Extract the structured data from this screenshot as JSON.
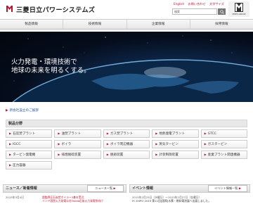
{
  "header": {
    "brand": "三菱日立パワーシステムズ",
    "util_links": [
      "English",
      "お問い合わせ",
      "文字サイズ"
    ],
    "search_placeholder": "検索",
    "search_button": "検索",
    "group_logo_text": "MHPS GROUP"
  },
  "nav": [
    "製品情報",
    "技術情報",
    "企業情報",
    "採用情報"
  ],
  "hero": {
    "line1": "火力発電・環境技術で",
    "line2": "地球の未来を明るくする。"
  },
  "notice": "新会社設立のご挨拶",
  "products": {
    "title": "製品分野",
    "items": [
      "石炭焚プラント",
      "油焚プラント",
      "ガス焚プラント",
      "地熱発電プラント",
      "GTCC",
      "IGCC",
      "ボイラ",
      "ボイラ周辺機器",
      "蒸気タービン",
      "ガスタービン",
      "タービン発電機",
      "排煙脱硫装置",
      "脱硝装置",
      "計装制御装置",
      "産業プラント関連機器",
      "圧力容器"
    ]
  },
  "news": {
    "title": "ニュース／新着情報",
    "button": "ニュース一覧",
    "date": "2015年3月4日",
    "lines": [
      "超臨界圧石炭焚ボイラー3基を受注",
      "インド国営火力発電公社Tanda石炭火力発電所向け"
    ]
  },
  "events": {
    "title": "イベント情報",
    "button": "イベント情報一覧",
    "date": "2015年2月25日（水曜日）～2015年2月27日（金曜日）",
    "line2": "FC EXPO 2015 第11回[国際]水素・燃料電池展へ出展しました。"
  },
  "colors": {
    "accent": "#b5162b",
    "link": "#1b4fa0"
  }
}
